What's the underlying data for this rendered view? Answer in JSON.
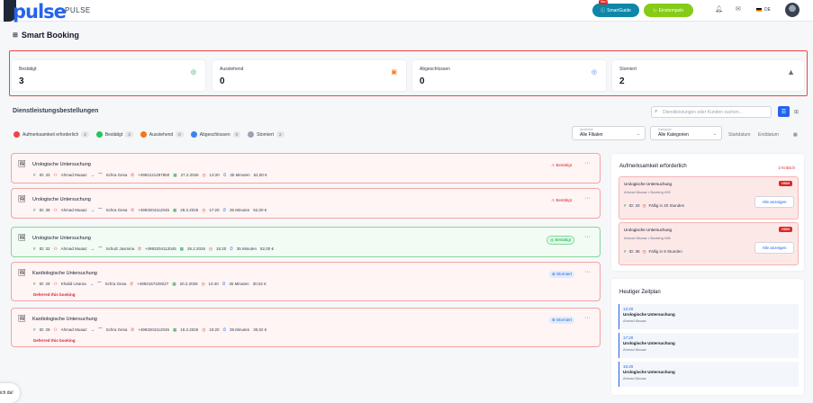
{
  "header": {
    "logo_text": "pulse",
    "logo_sub": "PULSE",
    "smartguide_badge": "Neu",
    "smartguide_label": "SmartGuide",
    "einstempeln_label": "Einstempeln",
    "lang": "DE",
    "icons": [
      "bell-icon",
      "mail-icon",
      "flag-de-icon",
      "avatar"
    ]
  },
  "page": {
    "title": "Smart Booking"
  },
  "stats": [
    {
      "label": "Bestätigt",
      "value": "3",
      "icon": "check-circle-icon",
      "color": "#16a34a"
    },
    {
      "label": "Ausstehend",
      "value": "0",
      "icon": "clipboard-icon",
      "color": "#f97316"
    },
    {
      "label": "Abgeschlossen",
      "value": "0",
      "icon": "check-circle-icon",
      "color": "#3b82f6"
    },
    {
      "label": "Storniert",
      "value": "2",
      "icon": "warning-triangle-icon",
      "color": "#6b7280"
    }
  ],
  "orders": {
    "title": "Dienstleistungsbestellungen",
    "search_placeholder": "Dienstleistungen oder Kunden suchen...",
    "filters": [
      {
        "label": "Aufmerksamkeit erforderlich",
        "count": "2",
        "color": "#ef4444"
      },
      {
        "label": "Bestätigt",
        "count": "3",
        "color": "#22c55e"
      },
      {
        "label": "Ausstehend",
        "count": "0",
        "color": "#f97316"
      },
      {
        "label": "Abgeschlossen",
        "count": "0",
        "color": "#3b82f6"
      },
      {
        "label": "Storniert",
        "count": "2",
        "color": "#9ca3af"
      }
    ],
    "branch_caption": "Apotheke",
    "branch_value": "Alle Filialen",
    "category_caption": "Kategorie",
    "category_value": "Alle Kategorien",
    "start_date": "Startdatum",
    "end_date": "Enddatum",
    "items": [
      {
        "service": "Urologische Untersuchung",
        "id": "ID: 33",
        "customer": "Ahmad Muaaz",
        "staff": "Schra Gesa",
        "phone": "+4992121497860",
        "date": "27.2.2026",
        "time": "13:20",
        "duration": "35 Minuten",
        "price": "52,00 €",
        "status": "Bestätigt",
        "deferred": ""
      },
      {
        "service": "Urologische Untersuchung",
        "id": "ID: 38",
        "customer": "Ahmad Muaaz",
        "staff": "Schra Gesa",
        "phone": "+4993204112045",
        "date": "28.2.2026",
        "time": "17:20",
        "duration": "35 Minuten",
        "price": "52,00 €",
        "status": "Bestätigt",
        "deferred": ""
      },
      {
        "service": "Urologische Untersuchung",
        "id": "ID: 32",
        "customer": "Ahmad Muaaz",
        "staff": "Schulz Jasmina",
        "phone": "+4993204112045",
        "date": "26.2.2026",
        "time": "15:20",
        "duration": "35 Minuten",
        "price": "52,00 €",
        "status": "Bestätigt",
        "deferred": ""
      },
      {
        "service": "Kardiologische Untersuchung",
        "id": "ID: 29",
        "customer": "Khalid Usama",
        "staff": "Schra Gesa",
        "phone": "+4992167229227",
        "date": "20.2.2026",
        "time": "14:40",
        "duration": "35 Minuten",
        "price": "30,02 €",
        "status": "Storniert",
        "deferred": "Deferred this booking"
      },
      {
        "service": "Kardiologische Untersuchung",
        "id": "ID: 28",
        "customer": "Ahmad Muaaz",
        "staff": "Schra Gesa",
        "phone": "+4993204112045",
        "date": "19.2.2026",
        "time": "15:20",
        "duration": "35 Minuten",
        "price": "30,02 €",
        "status": "Storniert",
        "deferred": "Deferred this booking"
      }
    ]
  },
  "attention": {
    "title": "Aufmerksamkeit erforderlich",
    "critical": "2 Kritisch",
    "items": [
      {
        "title": "Urologische Untersuchung",
        "sub": "Ahmad Muaaz • Booking #33",
        "id": "ID: 33",
        "due": "Fällig in 20 Stunden",
        "priority": "HIGH",
        "button": "Alle anzeigen"
      },
      {
        "title": "Urologische Untersuchung",
        "sub": "Ahmad Muaaz • Booking #38",
        "id": "ID: 38",
        "due": "Fällig in 9 Stunden",
        "priority": "HIGH",
        "button": "Alle anzeigen"
      }
    ]
  },
  "schedule": {
    "title": "Heutiger Zeitplan",
    "items": [
      {
        "time": "13:20",
        "title": "Urologische Untersuchung",
        "name": "Ahmad Muaaz"
      },
      {
        "time": "17:20",
        "title": "Urologische Untersuchung",
        "name": "Ahmad Muaaz"
      },
      {
        "time": "15:20",
        "title": "Urologische Untersuchung",
        "name": "Ahmad Muaaz"
      }
    ]
  },
  "chat": {
    "label": "ich da!"
  }
}
